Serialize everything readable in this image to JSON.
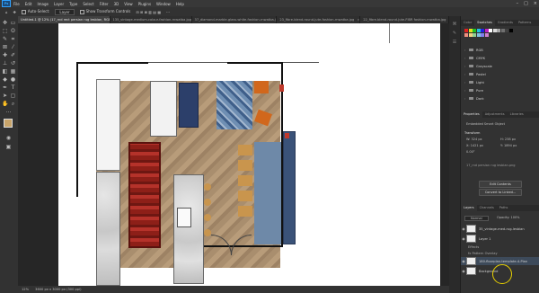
{
  "app": {
    "menu": [
      "File",
      "Edit",
      "Image",
      "Layer",
      "Type",
      "Select",
      "Filter",
      "3D",
      "View",
      "Plugins",
      "Window",
      "Help"
    ]
  },
  "options_bar": {
    "auto_select_label": "Auto-Select:",
    "auto_select_value": "Layer",
    "transform_label": "Show Transform Controls"
  },
  "tabs": [
    {
      "label": "Untitled-1 @ 12% (17_rnd rect persian rug lesbian, RGB/8)*",
      "active": true
    },
    {
      "label": "135_vintage-medium-colour-fashion-rnwatba.jpg",
      "active": false
    },
    {
      "label": "37_diamond-marble-glass-white-fashion-rnwatba.jpg",
      "active": false
    },
    {
      "label": "23_fibre-blend-round-jute-fashion-rnwatba.jpg",
      "active": false
    },
    {
      "label": "22_fibre-blend-round-jute-FIBR fashion-rnwatba.jpg",
      "active": false
    }
  ],
  "status": {
    "zoom": "12%",
    "doc": "3600 px x 3000 px (300 ppi)"
  },
  "swatches_panel": {
    "tabs": [
      "Color",
      "Swatches",
      "Gradients",
      "Patterns"
    ],
    "colors": [
      "#e02020",
      "#e0e020",
      "#20c020",
      "#20c0e0",
      "#2020e0",
      "#c020c0",
      "#ffffff",
      "#d8d8d8",
      "#a8a8a8",
      "#707070",
      "#404040",
      "#000000",
      "#f09080",
      "#f0d080",
      "#90d090",
      "#80c0e0",
      "#8080f0",
      "#d080d0"
    ],
    "groups": [
      "RGB",
      "CMYK",
      "Grayscale",
      "Pastel",
      "Light",
      "Pure",
      "Dark"
    ]
  },
  "properties_panel": {
    "tabs": [
      "Properties",
      "Adjustments",
      "Libraries"
    ],
    "type": "Embedded Smart Object",
    "transform": "Transform",
    "w": "W: 324 px",
    "h": "H: 238 px",
    "x": "X: 1421 px",
    "y": "Y: 1894 px",
    "angle": "0.00°",
    "filename": "17_rnd persian rug lesbian.png",
    "btn_edit": "Edit Contents",
    "btn_convert": "Convert to Linked..."
  },
  "layers_panel": {
    "tabs": [
      "Layers",
      "Channels",
      "Paths"
    ],
    "blend": "Normal",
    "opacity": "Opacity: 100%",
    "items": [
      {
        "name": "35_vintage-med-rug-lesbian",
        "sub": false,
        "sel": false
      },
      {
        "name": "Layer 1",
        "sub": false,
        "sel": false
      },
      {
        "name": "Effects",
        "sub": true,
        "sel": false
      },
      {
        "name": "fx Pattern Overlay",
        "sub": true,
        "sel": false
      },
      {
        "name": "180-floorplan-template-4-Plan",
        "sub": false,
        "sel": true
      },
      {
        "name": "Background",
        "sub": false,
        "sel": false
      }
    ]
  }
}
